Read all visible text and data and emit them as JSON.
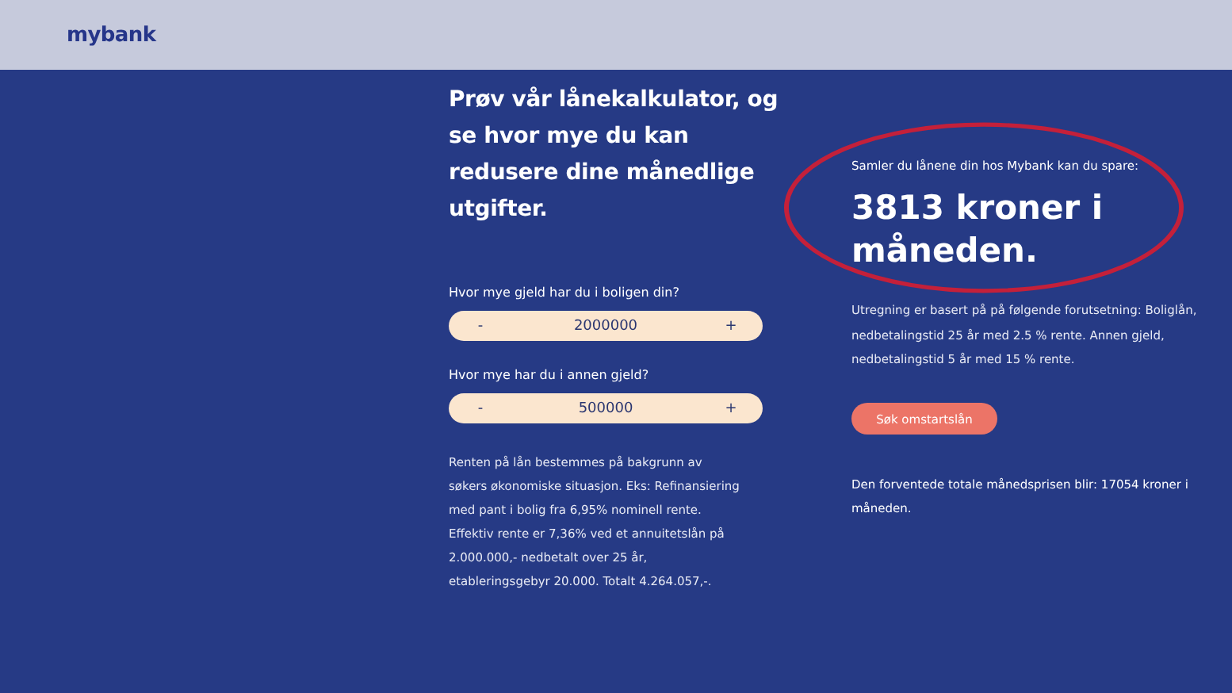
{
  "header": {
    "logo": "mybank"
  },
  "intro": "Prøv vår lånekalkulator, og se hvor mye du kan redusere dine månedlige utgifter.",
  "fields": [
    {
      "label": "Hvor mye gjeld har du i boligen din?",
      "minus": "-",
      "value": "2000000",
      "plus": "+"
    },
    {
      "label": "Hvor mye har du i annen gjeld?",
      "minus": "-",
      "value": "500000",
      "plus": "+"
    }
  ],
  "disclaimer": "Renten på lån bestemmes på bakgrunn av søkers økonomiske situasjon. Eks: Refinansiering med pant i bolig fra 6,95% nominell rente. Effektiv rente er 7,36% ved et annuitetslån på 2.000.000,- nedbetalt over 25 år, etableringsgebyr 20.000. Totalt 4.264.057,-.",
  "result": {
    "lead": "Samler du lånene din hos Mybank kan du spare:",
    "amount": "3813 kroner i måneden.",
    "highlighted": true,
    "basis": "Utregning er basert på på følgende forutsetning: Boliglån, nedbetalingstid 25 år med 2.5 % rente. Annen gjeld, nedbetalingstid 5 år med 15 % rente.",
    "button": "Søk omstartslån",
    "total": "Den forventede totale månedsprisen blir: 17054 kroner i måneden."
  }
}
